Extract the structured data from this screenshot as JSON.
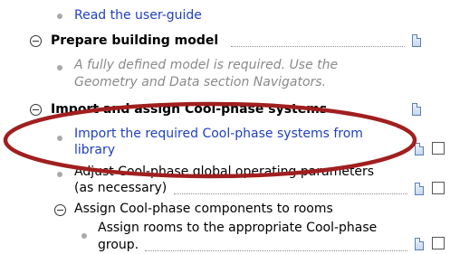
{
  "items": {
    "read_guide": "Read the user-guide",
    "prepare_model": "Prepare building model",
    "model_note_1": "A fully defined model is required. Use the",
    "model_note_2": "Geometry and Data section Navigators.",
    "import_assign": "Import and assign Cool-phase systems",
    "import_link_1": "Import the required Cool-phase systems from",
    "import_link_2": "library",
    "adjust_1": "Adjust Cool-phase global operating parameters",
    "adjust_2": "(as necessary)",
    "assign_components": "Assign Cool-phase components to rooms",
    "assign_rooms_1": "Assign rooms to the appropriate Cool-phase",
    "assign_rooms_2": "group."
  },
  "colors": {
    "link": "#1f3fbf",
    "highlight_ellipse": "#a11f1f",
    "note_text": "#8a8a8a"
  }
}
